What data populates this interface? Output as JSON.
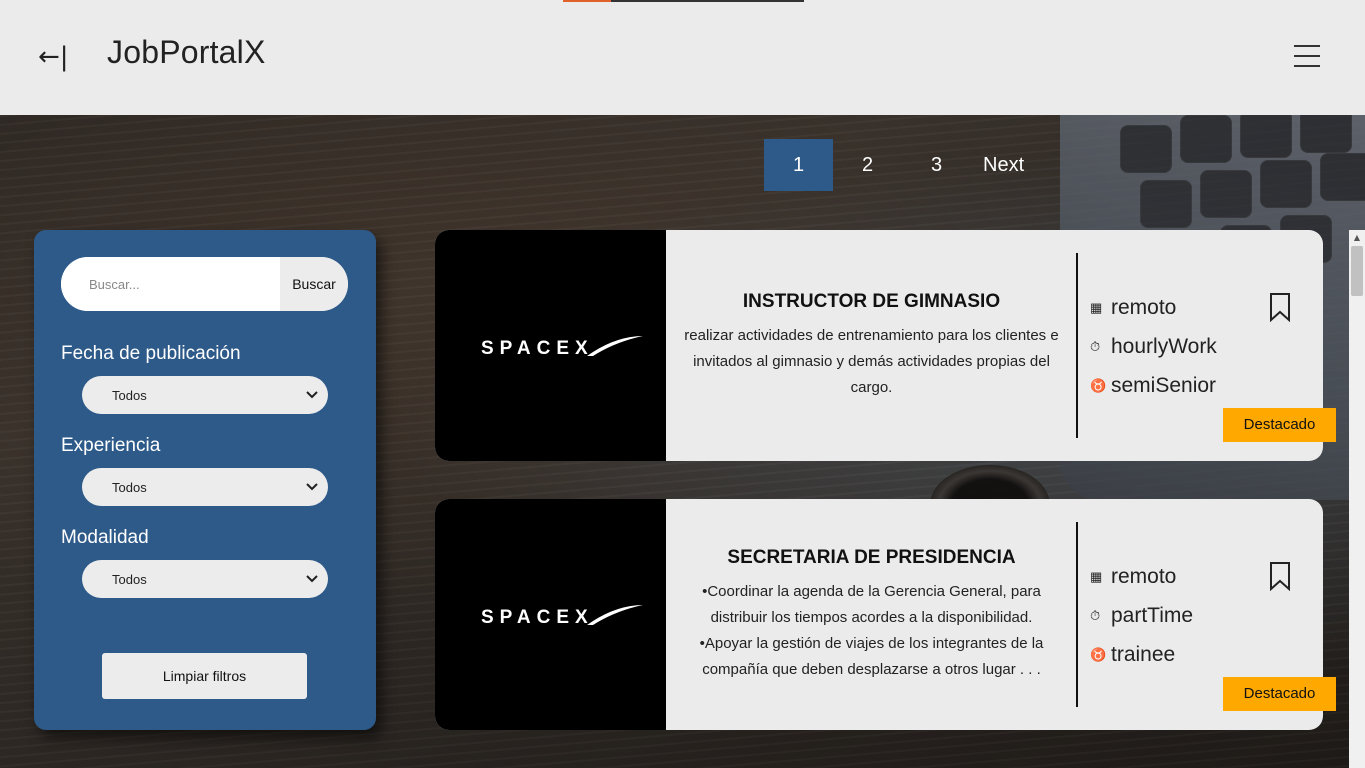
{
  "header": {
    "back_icon": "←|",
    "brand": "JobPortalX",
    "menu_icon": "hamburger-icon"
  },
  "pagination": {
    "pages": [
      "1",
      "2",
      "3"
    ],
    "active": "1",
    "next_label": "Next"
  },
  "filters": {
    "search_placeholder": "Buscar...",
    "search_button": "Buscar",
    "groups": [
      {
        "label": "Fecha de publicación",
        "value": "Todos"
      },
      {
        "label": "Experiencia",
        "value": "Todos"
      },
      {
        "label": "Modalidad",
        "value": "Todos"
      }
    ],
    "clear_button": "Limpiar filtros"
  },
  "jobs": [
    {
      "company_logo": "SPACEX",
      "title": "INSTRUCTOR DE GIMNASIO",
      "description": "realizar actividades de entrenamiento para los clientes e invitados al gimnasio y demás actividades propias del cargo.",
      "modality": "remoto",
      "schedule": "hourlyWork",
      "level": "semiSenior",
      "badge": "Destacado"
    },
    {
      "company_logo": "SPACEX",
      "title": "SECRETARIA DE PRESIDENCIA",
      "description_lines": [
        "•Coordinar la agenda de la Gerencia General, para distribuir los tiempos acordes a la disponibilidad.",
        "•Apoyar la gestión de viajes de los integrantes de la compañía que deben desplazarse a otros lugar . . ."
      ],
      "modality": "remoto",
      "schedule": "partTime",
      "level": "trainee",
      "badge": "Destacado"
    }
  ],
  "colors": {
    "header_bg": "#ebebeb",
    "panel_blue": "#2e5a89",
    "badge_orange": "#ffa800",
    "accent_orange": "#e0622a"
  }
}
